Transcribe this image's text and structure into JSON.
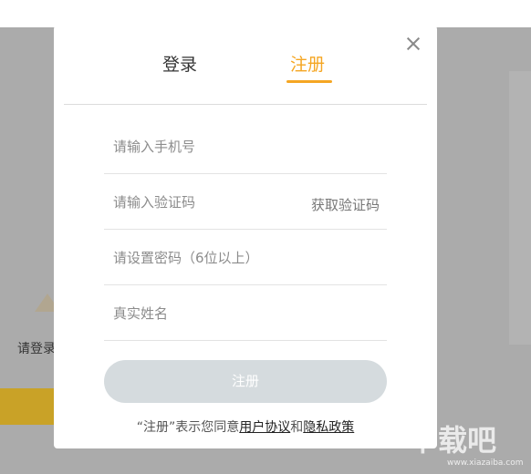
{
  "background": {
    "login_hint": "请登录"
  },
  "modal": {
    "tabs": {
      "login": "登录",
      "register": "注册"
    },
    "fields": {
      "phone_placeholder": "请输入手机号",
      "code_placeholder": "请输入验证码",
      "get_code": "获取验证码",
      "password_placeholder": "请设置密码（6位以上）",
      "name_placeholder": "真实姓名"
    },
    "submit_label": "注册",
    "agreement": {
      "prefix": "“注册”表示您同意",
      "user_agreement": "用户协议",
      "and": "和",
      "privacy_policy": "隐私政策"
    }
  },
  "watermark": {
    "logo_text": "下载吧",
    "url": "www.xiazaiba.com"
  },
  "colors": {
    "accent": "#f5a623",
    "button_disabled": "#d5dbde",
    "overlay": "#ababab"
  }
}
